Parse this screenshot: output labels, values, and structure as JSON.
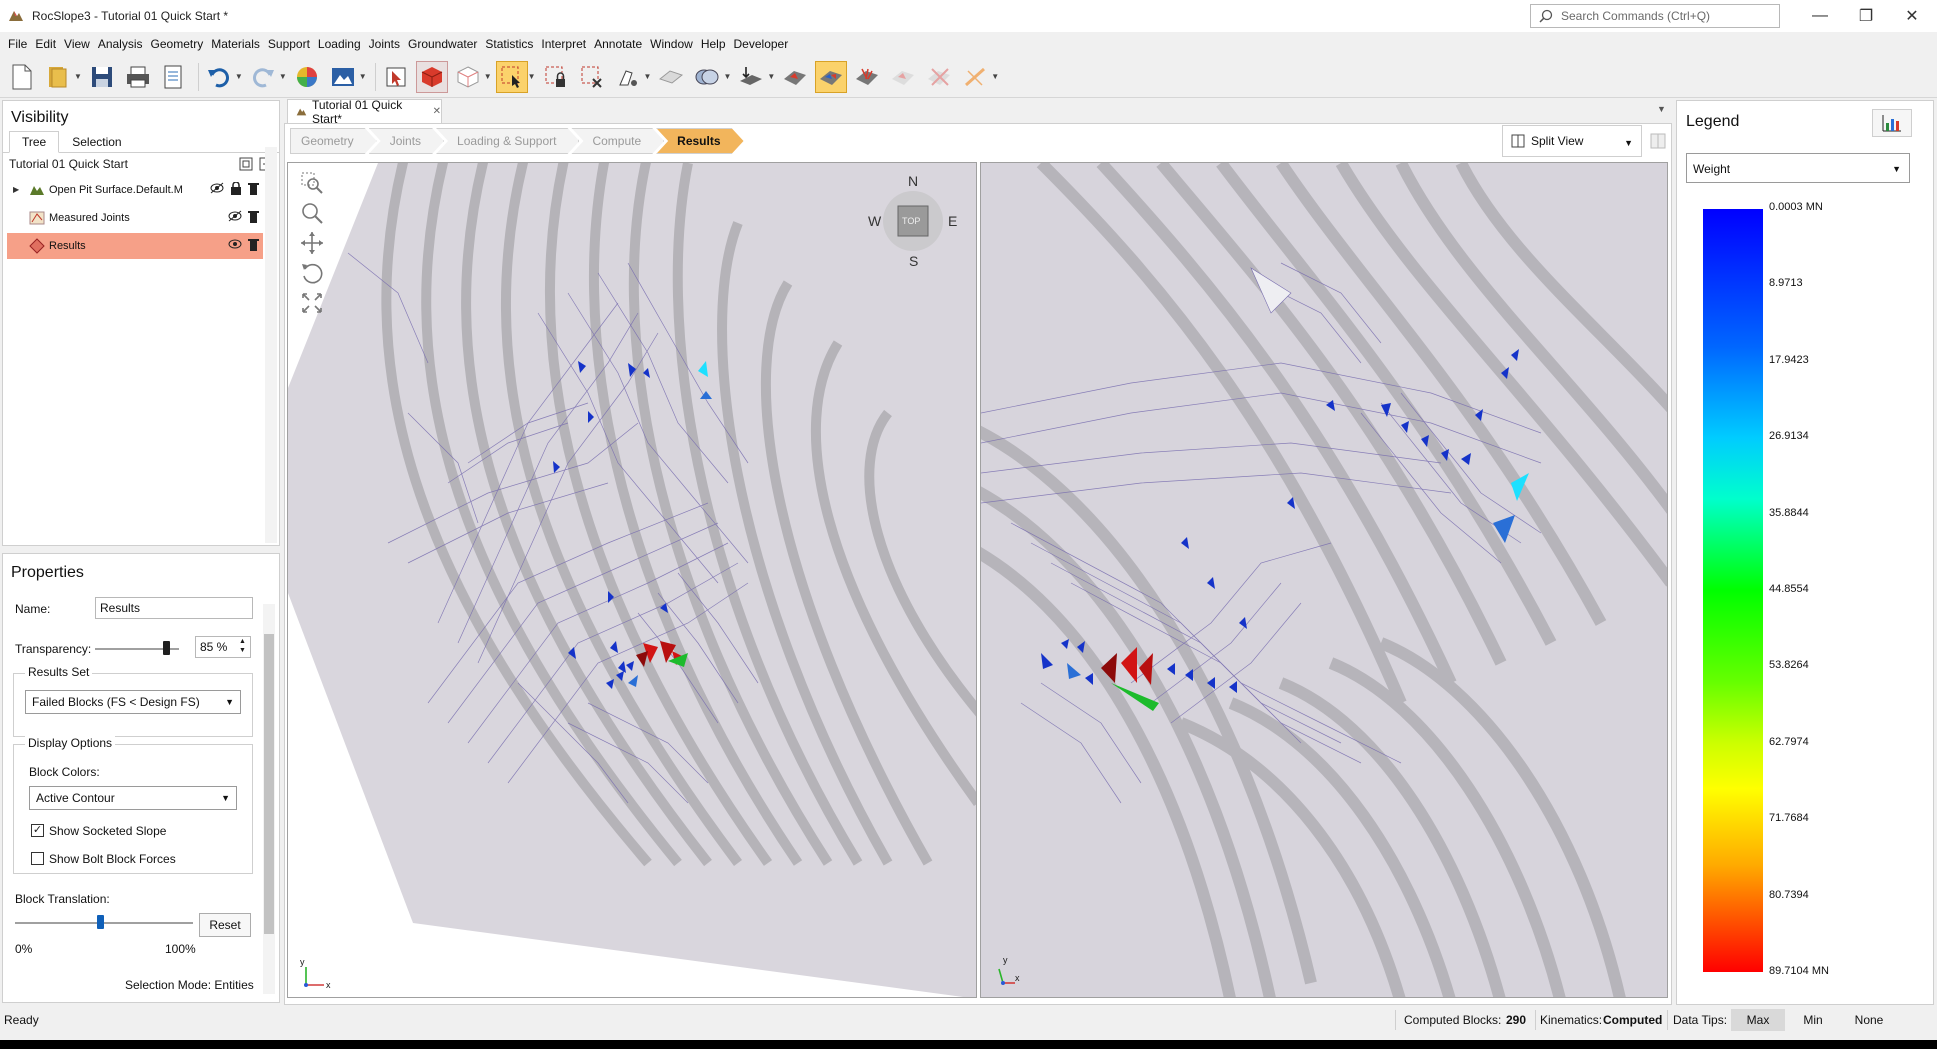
{
  "window": {
    "title": "RocSlope3 - Tutorial 01 Quick Start *",
    "search_placeholder": "Search Commands (Ctrl+Q)",
    "minimize": "—",
    "maximize": "❐",
    "close": "✕"
  },
  "menu": [
    "File",
    "Edit",
    "View",
    "Analysis",
    "Geometry",
    "Materials",
    "Support",
    "Loading",
    "Joints",
    "Groundwater",
    "Statistics",
    "Interpret",
    "Annotate",
    "Window",
    "Help",
    "Developer"
  ],
  "toolbar": {
    "icons": [
      "new-file-icon",
      "open-folder-icon",
      "save-icon",
      "print-icon",
      "report-icon",
      "undo-icon",
      "redo-icon",
      "color-wheel-icon",
      "export-image-icon",
      "select-pointer-icon",
      "solid-cube-icon",
      "wire-cube-icon",
      "box-select-icon",
      "lock-select-icon",
      "clear-select-icon",
      "probe-icon",
      "plane-icon",
      "joint-sets-icon",
      "load-icon",
      "failed-blocks-icon",
      "all-blocks-icon",
      "block-contour-icon",
      "compare-icon",
      "delete-block-icon",
      "measure-icon"
    ],
    "active": [
      "box-select-icon",
      "all-blocks-icon"
    ]
  },
  "visibility": {
    "title": "Visibility",
    "tabs": [
      "Tree",
      "Selection"
    ],
    "active_tab": "Tree",
    "root": "Tutorial 01 Quick Start",
    "items": [
      {
        "label": "Open Pit Surface.Default.M",
        "selected": false
      },
      {
        "label": "Measured Joints",
        "selected": false
      },
      {
        "label": "Results",
        "selected": true
      }
    ]
  },
  "properties": {
    "title": "Properties",
    "name_label": "Name:",
    "name_value": "Results",
    "transparency_label": "Transparency:",
    "transparency_value": "85 %",
    "transparency_level": 0.85,
    "results_set_label": "Results Set",
    "results_set_value": "Failed Blocks (FS < Design FS)",
    "display_options_label": "Display Options",
    "block_colors_label": "Block Colors:",
    "block_colors_value": "Active Contour",
    "show_socketed_slope": "Show Socketed Slope",
    "show_socketed_slope_checked": true,
    "show_bolt_block_forces": "Show Bolt Block Forces",
    "show_bolt_block_forces_checked": false,
    "block_translation_label": "Block Translation:",
    "block_translation_level": 0.48,
    "reset_label": "Reset",
    "min_label": "0%",
    "max_label": "100%",
    "selection_mode": "Selection Mode: Entities"
  },
  "document": {
    "tab_label": "Tutorial 01 Quick Start*",
    "tab_close": "✕",
    "workflow": [
      "Geometry",
      "Joints",
      "Loading & Support",
      "Compute",
      "Results"
    ],
    "active_step": "Results",
    "view_mode": "Split View"
  },
  "compass": {
    "north": "N",
    "south": "S",
    "east": "E",
    "west": "W",
    "face": "TOP"
  },
  "axis_labels": {
    "x": "x",
    "y": "y"
  },
  "legend": {
    "title": "Legend",
    "selected": "Weight",
    "labels": [
      "0.0003 MN",
      "8.9713",
      "17.9423",
      "26.9134",
      "35.8844",
      "44.8554",
      "53.8264",
      "62.7974",
      "71.7684",
      "80.7394",
      "89.7104 MN"
    ]
  },
  "status": {
    "ready": "Ready",
    "computed_blocks_label": "Computed Blocks:",
    "computed_blocks_value": "290",
    "kinematics_label": "Kinematics:",
    "kinematics_value": "Computed",
    "data_tips_label": "Data Tips:",
    "data_tips_options": [
      "Max",
      "Min",
      "None"
    ],
    "data_tips_active": "Max"
  }
}
